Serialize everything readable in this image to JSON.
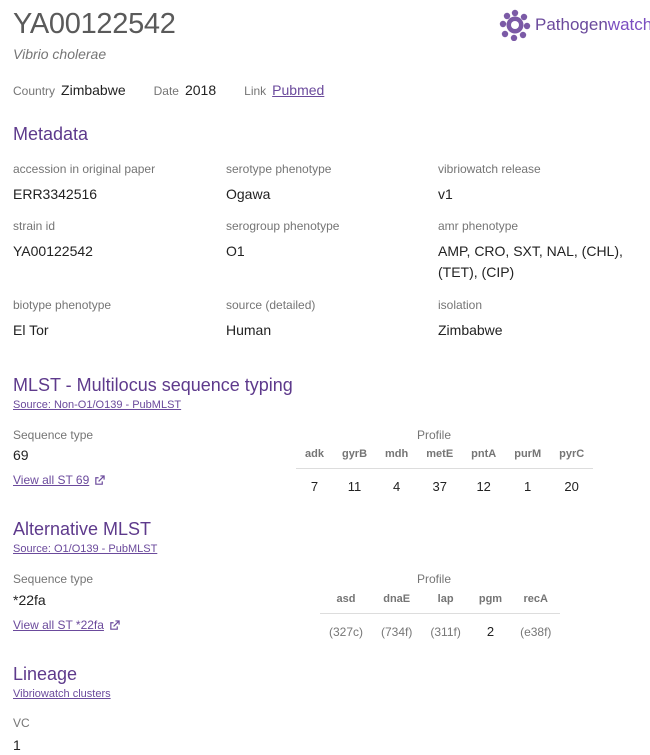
{
  "header": {
    "title": "YA00122542",
    "species": "Vibrio cholerae",
    "logo_text_a": "Pathogen",
    "logo_text_b": "watch",
    "country_label": "Country",
    "country": "Zimbabwe",
    "date_label": "Date",
    "date": "2018",
    "link_label": "Link",
    "link": "Pubmed"
  },
  "metadata": {
    "heading": "Metadata",
    "fields": [
      {
        "label": "accession in original paper",
        "value": "ERR3342516"
      },
      {
        "label": "serotype phenotype",
        "value": "Ogawa"
      },
      {
        "label": "vibriowatch release",
        "value": "v1"
      },
      {
        "label": "strain id",
        "value": "YA00122542"
      },
      {
        "label": "serogroup phenotype",
        "value": "O1"
      },
      {
        "label": "amr phenotype",
        "value": "AMP, CRO, SXT, NAL, (CHL), (TET), (CIP)"
      },
      {
        "label": "biotype phenotype",
        "value": "El Tor"
      },
      {
        "label": "source (detailed)",
        "value": "Human"
      },
      {
        "label": "isolation",
        "value": "Zimbabwe"
      }
    ]
  },
  "mlst": {
    "heading": "MLST - Multilocus sequence typing",
    "source": "Source: Non-O1/O139 - PubMLST",
    "st_label": "Sequence type",
    "st_value": "69",
    "view_all": "View all ST 69",
    "profile_label": "Profile",
    "loci": [
      "adk",
      "gyrB",
      "mdh",
      "metE",
      "pntA",
      "purM",
      "pyrC"
    ],
    "alleles": [
      "7",
      "11",
      "4",
      "37",
      "12",
      "1",
      "20"
    ]
  },
  "alt_mlst": {
    "heading": "Alternative MLST",
    "source": "Source: O1/O139 - PubMLST",
    "st_label": "Sequence type",
    "st_value": "*22fa",
    "view_all": "View all ST *22fa",
    "profile_label": "Profile",
    "loci": [
      "asd",
      "dnaE",
      "lap",
      "pgm",
      "recA"
    ],
    "alleles": [
      "(327c)",
      "(734f)",
      "(311f)",
      "2",
      "(e38f)"
    ]
  },
  "lineage": {
    "heading": "Lineage",
    "source": "Vibriowatch clusters",
    "vc_label": "VC",
    "vc_value": "1"
  },
  "icons": {
    "logo": "pathogenwatch-gear-icon",
    "external": "external-link-icon"
  },
  "colors": {
    "accent": "#5e3a8c",
    "link": "#6b4a9c"
  }
}
